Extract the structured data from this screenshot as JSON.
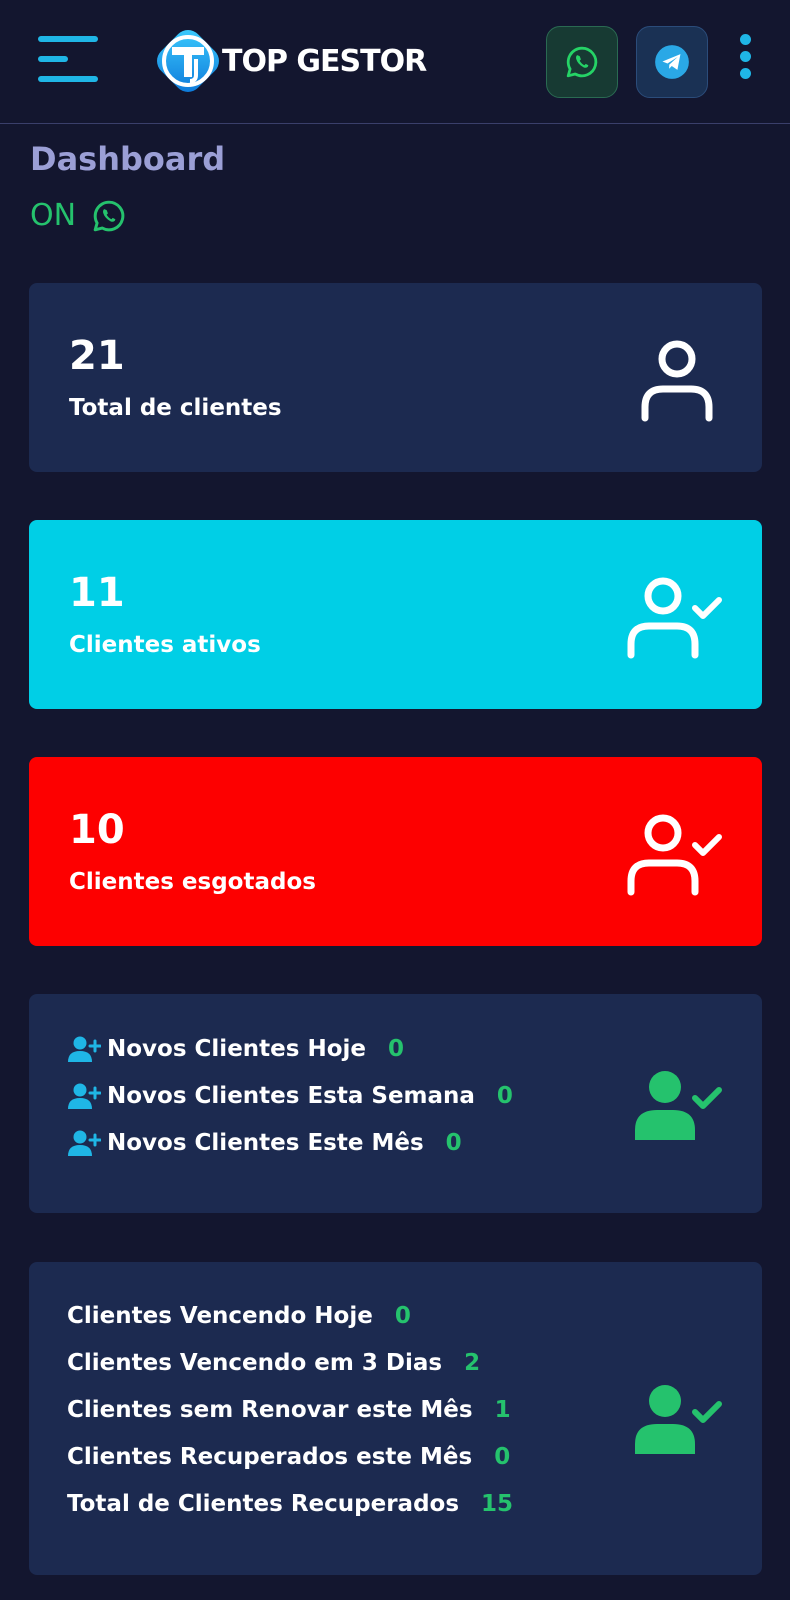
{
  "header": {
    "brand": "TOP GESTOR",
    "logo_letters": "TG"
  },
  "page": {
    "title": "Dashboard",
    "status": "ON"
  },
  "stats": [
    {
      "value": "21",
      "label": "Total de clientes"
    },
    {
      "value": "11",
      "label": "Clientes ativos"
    },
    {
      "value": "10",
      "label": "Clientes esgotados"
    }
  ],
  "new_clients": [
    {
      "label": "Novos Clientes Hoje",
      "value": "0"
    },
    {
      "label": "Novos Clientes Esta Semana",
      "value": "0"
    },
    {
      "label": "Novos Clientes Este Mês",
      "value": "0"
    }
  ],
  "expiring": [
    {
      "label": "Clientes Vencendo Hoje",
      "value": "0"
    },
    {
      "label": "Clientes Vencendo em 3 Dias",
      "value": "2"
    },
    {
      "label": "Clientes sem Renovar este Mês",
      "value": "1"
    },
    {
      "label": "Clientes Recuperados este Mês",
      "value": "0"
    },
    {
      "label": "Total de Clientes Recuperados",
      "value": "15"
    }
  ],
  "colors": {
    "background": "#13162f",
    "card_navy": "#1c2a50",
    "card_cyan": "#00cfe6",
    "card_red": "#fd0000",
    "accent_blue": "#1fb6e6",
    "value_green": "#25c26d",
    "title_lavender": "#9b9fd6"
  },
  "icons": {
    "menu": "hamburger-menu-icon",
    "whatsapp": "whatsapp-icon",
    "telegram": "telegram-icon",
    "more": "kebab-menu-icon",
    "total": "user-outline-icon",
    "active": "user-check-outline-icon",
    "expired": "user-check-outline-icon",
    "new": "user-plus-icon",
    "summary": "user-check-filled-icon"
  }
}
